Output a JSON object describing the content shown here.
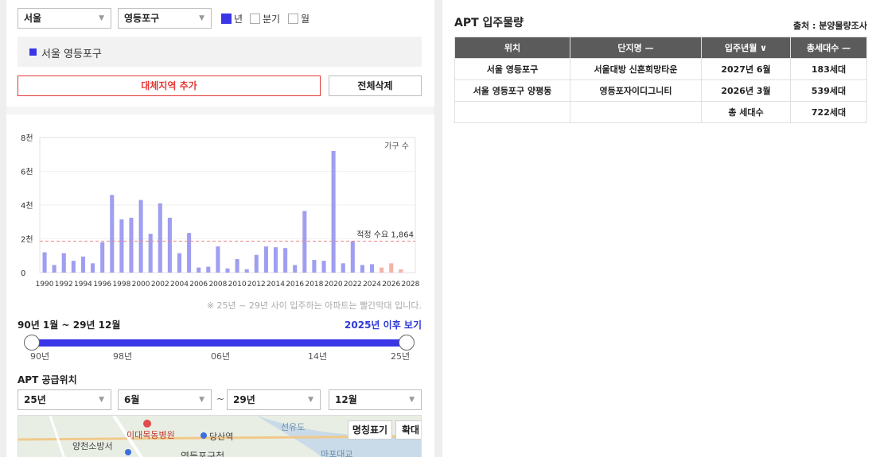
{
  "filters": {
    "city": "서울",
    "district": "영등포구",
    "periods": [
      {
        "label": "년",
        "checked": true
      },
      {
        "label": "분기",
        "checked": false
      },
      {
        "label": "월",
        "checked": false
      }
    ]
  },
  "selected_region": "서울 영등포구",
  "buttons": {
    "add_region": "대체지역 추가",
    "delete_all": "전체삭제"
  },
  "chart_data": {
    "type": "bar",
    "series_label": "가구 수",
    "y_ticks": [
      "0",
      "2천",
      "4천",
      "6천",
      "8천"
    ],
    "ylim": [
      0,
      8000
    ],
    "x": [
      1990,
      1991,
      1992,
      1993,
      1994,
      1995,
      1996,
      1997,
      1998,
      1999,
      2000,
      2001,
      2002,
      2003,
      2004,
      2005,
      2006,
      2007,
      2008,
      2009,
      2010,
      2011,
      2012,
      2013,
      2014,
      2015,
      2016,
      2017,
      2018,
      2019,
      2020,
      2021,
      2022,
      2023,
      2024,
      2025,
      2026,
      2027
    ],
    "values": [
      1200,
      450,
      1150,
      700,
      950,
      550,
      1800,
      4600,
      3150,
      3250,
      4300,
      2300,
      4100,
      3250,
      1150,
      2350,
      300,
      350,
      1550,
      250,
      800,
      200,
      1050,
      1550,
      1500,
      1450,
      450,
      3650,
      750,
      700,
      7200,
      550,
      1850,
      450,
      500,
      300,
      550,
      200
    ],
    "x_tick_labels": [
      "1990",
      "1992",
      "1994",
      "1996",
      "1998",
      "2000",
      "2002",
      "2004",
      "2006",
      "2008",
      "2010",
      "2012",
      "2014",
      "2016",
      "2018",
      "2020",
      "2022",
      "2024",
      "2026",
      "2028"
    ],
    "reference_line": {
      "label": "적정 수요 1,864",
      "value": 1864
    },
    "colors": {
      "past": "#a09ef0",
      "future": "#f4b3a8",
      "reference": "#e98a8a"
    },
    "future_from": 2025,
    "note": "※ 25년 ~ 29년 사이 입주하는 아파트는 빨간막대 입니다."
  },
  "period_range": "90년 1월 ~ 29년 12월",
  "after_2025_link": "2025년 이후 보기",
  "slider": {
    "ticks": [
      "90년",
      "98년",
      "06년",
      "14년",
      "25년"
    ],
    "start": "90년",
    "end": "25년"
  },
  "supply_title": "APT 공급위치",
  "range_selects": {
    "from_year": "25년",
    "from_month": "6월",
    "tilde": "~",
    "to_year": "29년",
    "to_month": "12월"
  },
  "map": {
    "buttons": {
      "name_toggle": "명칭표기",
      "zoom": "확대"
    },
    "labels": [
      "이대목동병원",
      "당산역",
      "양천소방서",
      "영등포구청",
      "선유도",
      "마포대교"
    ]
  },
  "apt": {
    "title": "APT 입주물량",
    "source": "출처 : 분양물량조사",
    "columns": [
      "위치",
      "단지명 —",
      "입주년월 ∨",
      "총세대수 —"
    ],
    "rows": [
      [
        "서울 영등포구",
        "서울대방 신혼희망타운",
        "2027년 6월",
        "183세대"
      ],
      [
        "서울 영등포구 양평동",
        "영등포자이디그니티",
        "2026년 3월",
        "539세대"
      ],
      [
        "",
        "",
        "총 세대수",
        "722세대"
      ]
    ]
  }
}
